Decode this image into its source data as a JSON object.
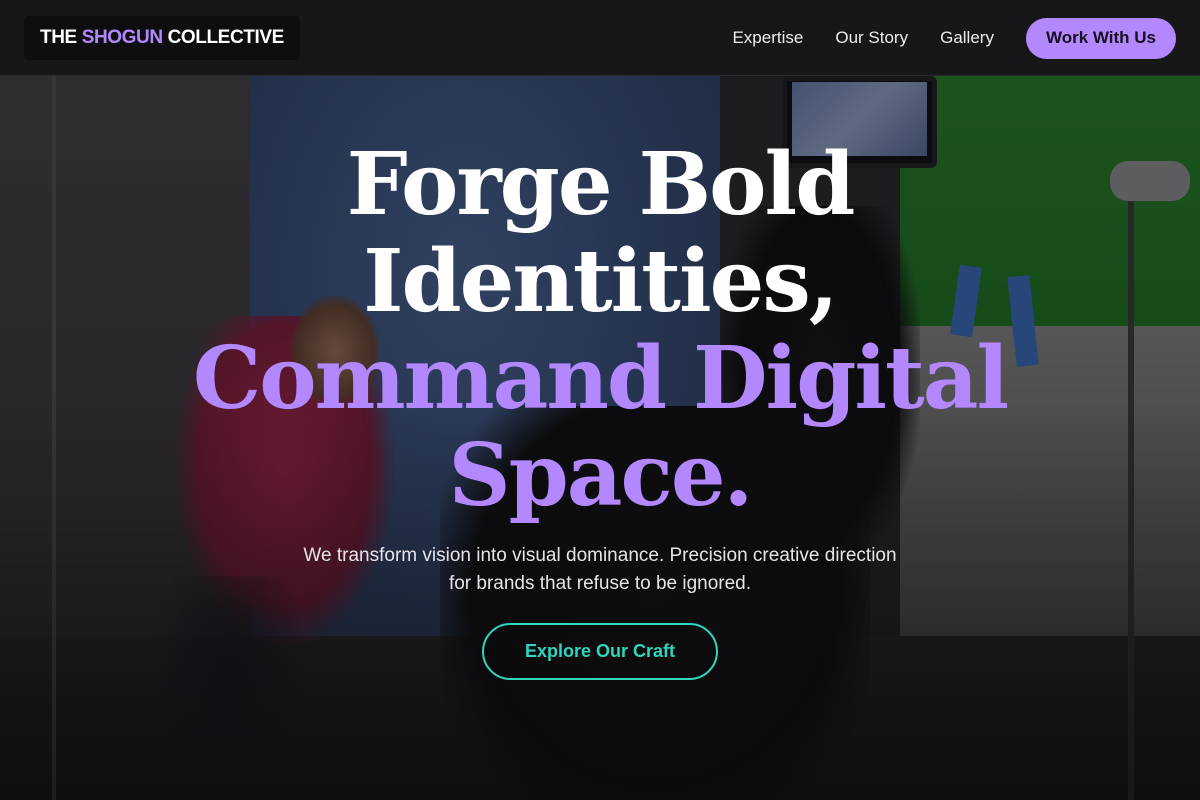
{
  "header": {
    "logo": {
      "prefix": "THE ",
      "accent": "SHOGUN",
      "suffix": " COLLECTIVE"
    },
    "nav": [
      {
        "label": "Expertise"
      },
      {
        "label": "Our Story"
      },
      {
        "label": "Gallery"
      }
    ],
    "cta_label": "Work With Us"
  },
  "hero": {
    "title_lines": [
      {
        "text": "Forge Bold",
        "tone": "white"
      },
      {
        "text": "Identities,",
        "tone": "white"
      },
      {
        "text": "Command Digital",
        "tone": "purple"
      },
      {
        "text": "Space.",
        "tone": "purple"
      }
    ],
    "subtitle_line1": "We transform vision into visual dominance. Precision creative direction",
    "subtitle_line2": "for brands that refuse to be ignored.",
    "button_label": "Explore Our Craft"
  },
  "colors": {
    "accent_purple": "#b388ff",
    "accent_teal": "#2fd6bd",
    "header_bg": "#17171a"
  }
}
